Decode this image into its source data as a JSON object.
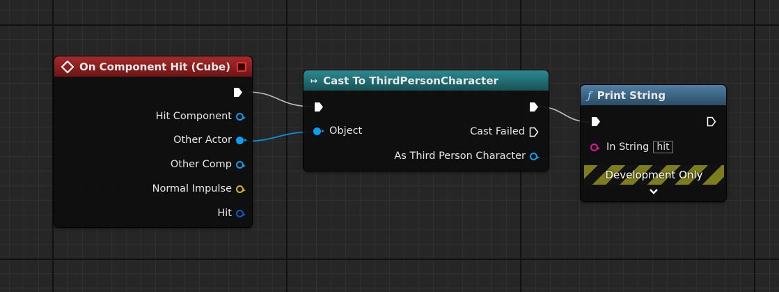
{
  "nodes": {
    "event": {
      "title": "On Component Hit (Cube)",
      "pins": [
        "Hit Component",
        "Other Actor",
        "Other Comp",
        "Normal Impulse",
        "Hit"
      ]
    },
    "cast": {
      "title": "Cast To ThirdPersonCharacter",
      "input": "Object",
      "outputs": [
        "Cast Failed",
        "As Third Person Character"
      ]
    },
    "print": {
      "title": "Print String",
      "input_label": "In String",
      "input_value": "hit",
      "banner": "Development Only"
    }
  },
  "colors": {
    "event_header": "#8e1d1d",
    "cast_header": "#1e6a70",
    "print_header": "#3f6a8c",
    "object_pin": "#0aa0f0",
    "struct_pin": "#0a5cc8",
    "vector_pin": "#d5b527",
    "string_pin": "#e0159e"
  }
}
